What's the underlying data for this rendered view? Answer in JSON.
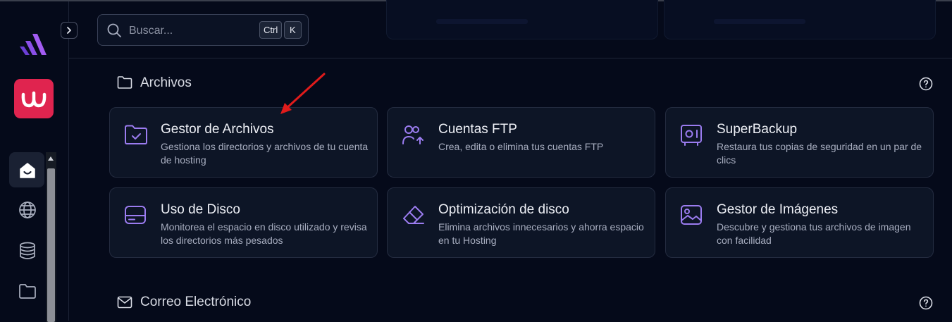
{
  "search": {
    "placeholder": "Buscar...",
    "shortcut_ctrl": "Ctrl",
    "shortcut_key": "K"
  },
  "sections": [
    {
      "title": "Archivos",
      "cards": [
        {
          "title": "Gestor de Archivos",
          "description": "Gestiona los directorios y archivos de tu cuenta de hosting",
          "icon": "folder-check-icon"
        },
        {
          "title": "Cuentas FTP",
          "description": "Crea, edita o elimina tus cuentas FTP",
          "icon": "users-upload-icon"
        },
        {
          "title": "SuperBackup",
          "description": "Restaura tus copias de seguridad en un par de clics",
          "icon": "safe-icon"
        },
        {
          "title": "Uso de Disco",
          "description": "Monitorea el espacio en disco utilizado y revisa los directorios más pesados",
          "icon": "hard-drive-icon"
        },
        {
          "title": "Optimización de disco",
          "description": "Elimina archivos innecesarios y ahorra espacio en tu Hosting",
          "icon": "eraser-icon"
        },
        {
          "title": "Gestor de Imágenes",
          "description": "Descubre y gestiona tus archivos de imagen con facilidad",
          "icon": "image-icon"
        }
      ]
    },
    {
      "title": "Correo Electrónico"
    }
  ],
  "colors": {
    "accent": "#9b7cf0",
    "brand": "#e0244f",
    "background": "#050a1a",
    "annotation": "#e01b1b"
  }
}
